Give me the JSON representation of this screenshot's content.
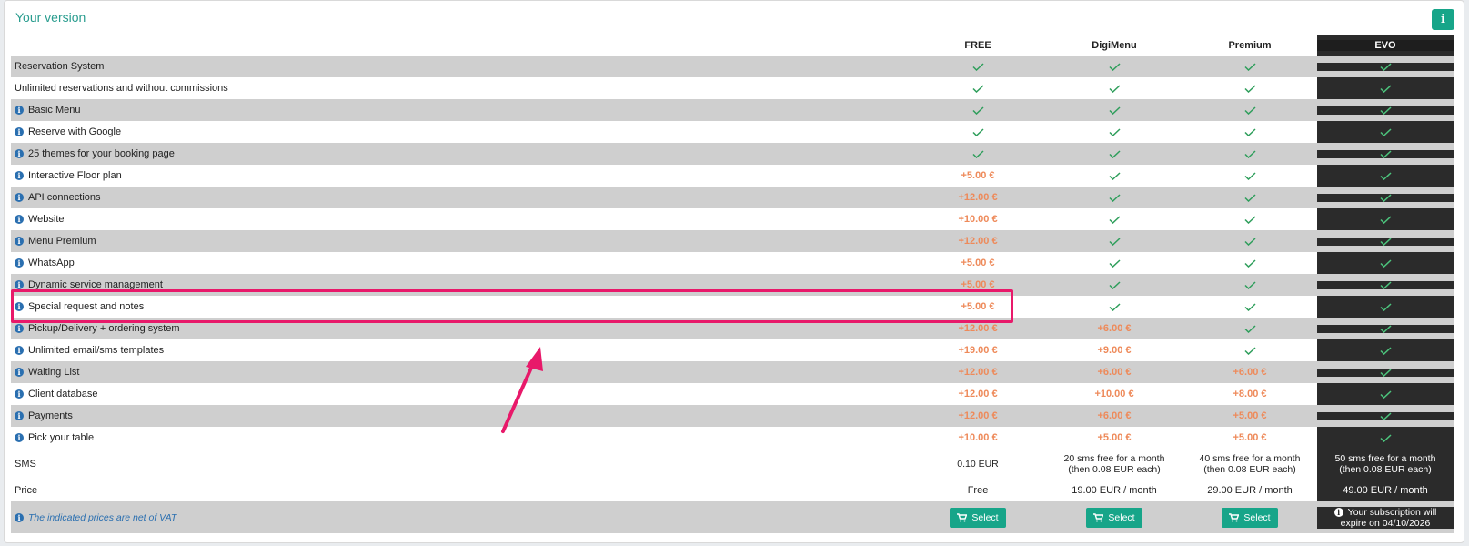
{
  "panel": {
    "title": "Your version",
    "info_button": "i"
  },
  "plans": [
    "FREE",
    "DigiMenu",
    "Premium",
    "EVO"
  ],
  "features": [
    {
      "label": "Reservation System",
      "info": false,
      "values": [
        "check",
        "check",
        "check",
        "check"
      ]
    },
    {
      "label": "Unlimited reservations and without commissions",
      "info": false,
      "values": [
        "check",
        "check",
        "check",
        "check"
      ]
    },
    {
      "label": "Basic Menu",
      "info": true,
      "values": [
        "check",
        "check",
        "check",
        "check"
      ]
    },
    {
      "label": "Reserve with Google",
      "info": true,
      "values": [
        "check",
        "check",
        "check",
        "check"
      ]
    },
    {
      "label": "25 themes for your booking page",
      "info": true,
      "values": [
        "check",
        "check",
        "check",
        "check"
      ]
    },
    {
      "label": "Interactive Floor plan",
      "info": true,
      "values": [
        "+5.00 €",
        "check",
        "check",
        "check"
      ]
    },
    {
      "label": "API connections",
      "info": true,
      "values": [
        "+12.00 €",
        "check",
        "check",
        "check"
      ]
    },
    {
      "label": "Website",
      "info": true,
      "values": [
        "+10.00 €",
        "check",
        "check",
        "check"
      ]
    },
    {
      "label": "Menu Premium",
      "info": true,
      "values": [
        "+12.00 €",
        "check",
        "check",
        "check"
      ]
    },
    {
      "label": "WhatsApp",
      "info": true,
      "values": [
        "+5.00 €",
        "check",
        "check",
        "check"
      ]
    },
    {
      "label": "Dynamic service management",
      "info": true,
      "values": [
        "+5.00 €",
        "check",
        "check",
        "check"
      ]
    },
    {
      "label": "Special request and notes",
      "info": true,
      "values": [
        "+5.00 €",
        "check",
        "check",
        "check"
      ]
    },
    {
      "label": "Pickup/Delivery + ordering system",
      "info": true,
      "values": [
        "+12.00 €",
        "+6.00 €",
        "check",
        "check"
      ]
    },
    {
      "label": "Unlimited email/sms templates",
      "info": true,
      "values": [
        "+19.00 €",
        "+9.00 €",
        "check",
        "check"
      ]
    },
    {
      "label": "Waiting List",
      "info": true,
      "values": [
        "+12.00 €",
        "+6.00 €",
        "+6.00 €",
        "check"
      ]
    },
    {
      "label": "Client database",
      "info": true,
      "values": [
        "+12.00 €",
        "+10.00 €",
        "+8.00 €",
        "check"
      ]
    },
    {
      "label": "Payments",
      "info": true,
      "values": [
        "+12.00 €",
        "+6.00 €",
        "+5.00 €",
        "check"
      ]
    },
    {
      "label": "Pick your table",
      "info": true,
      "values": [
        "+10.00 €",
        "+5.00 €",
        "+5.00 €",
        "check"
      ]
    }
  ],
  "sms": {
    "label": "SMS",
    "values": [
      [
        "0.10 EUR"
      ],
      [
        "20 sms free for a month",
        "(then 0.08 EUR each)"
      ],
      [
        "40 sms free for a month",
        "(then 0.08 EUR each)"
      ],
      [
        "50 sms free for a month",
        "(then 0.08 EUR each)"
      ]
    ]
  },
  "price": {
    "label": "Price",
    "values": [
      "Free",
      "19.00 EUR / month",
      "29.00 EUR / month",
      "49.00 EUR / month"
    ]
  },
  "footer": {
    "vat_note": "The indicated prices are net of VAT",
    "select_label": "Select",
    "subscription_note_1": "Your subscription will",
    "subscription_note_2": "expire on 04/10/2026"
  },
  "highlighted_feature": "Special request and notes",
  "colors": {
    "accent": "#17a589",
    "price": "#ee8a5a",
    "highlight": "#e8196a",
    "evo_bg": "#2b2b2b",
    "check": "#2e9e5b"
  }
}
